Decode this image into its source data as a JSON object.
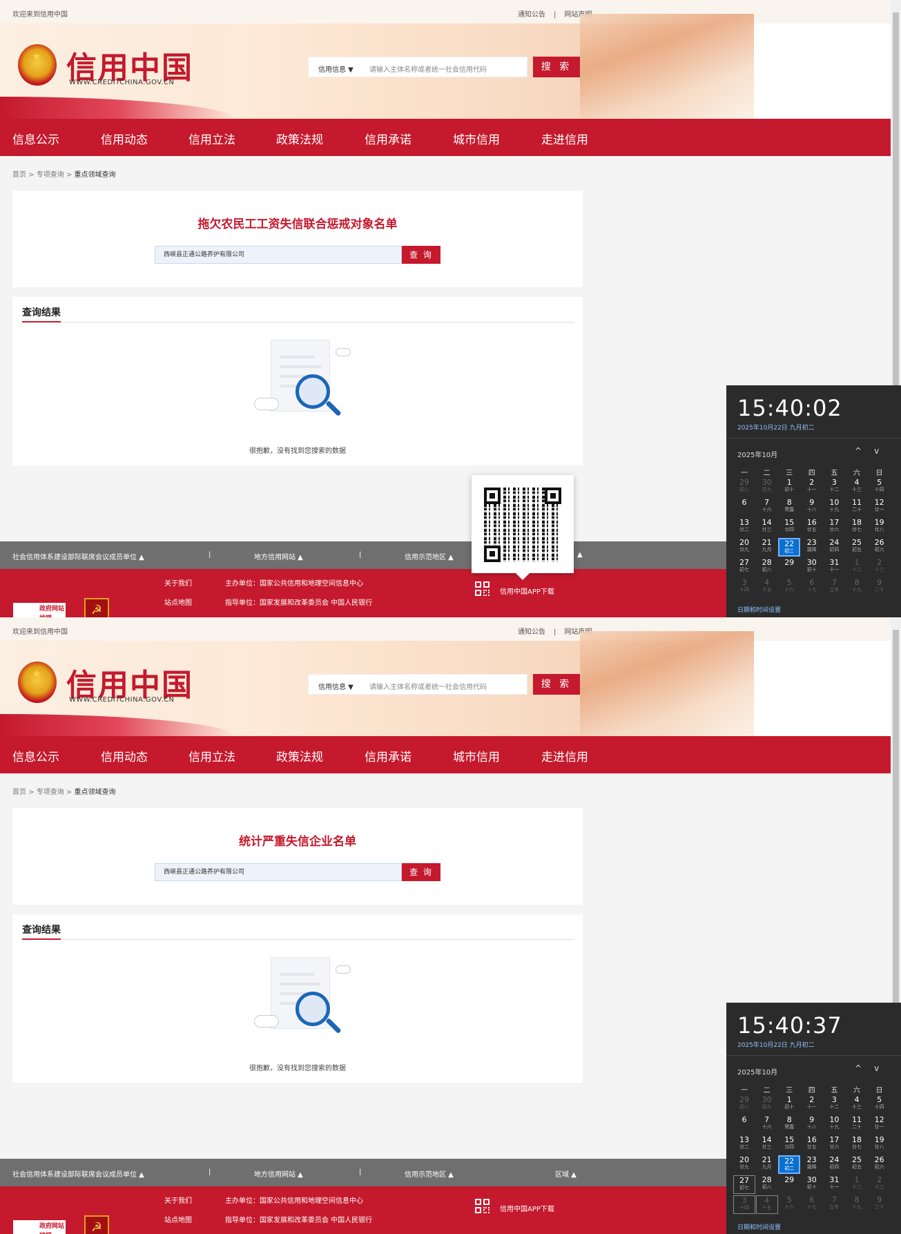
{
  "topbar": {
    "welcome": "欢迎来到信用中国",
    "notice": "通知公告",
    "divider": "|",
    "statement": "网站声明"
  },
  "logo": {
    "title": "信用中国",
    "subtitle": "WWW.CREDITCHINA.GOV.CN"
  },
  "search": {
    "category": "信用信息 ▼",
    "placeholder": "请输入主体名称或者统一社会信用代码",
    "button": "搜 索"
  },
  "nav": [
    "信息公示",
    "信用动态",
    "信用立法",
    "政策法规",
    "信用承诺",
    "城市信用",
    "走进信用"
  ],
  "breadcrumb": {
    "home": "首页",
    "sep1": " > ",
    "section": "专项查询",
    "sep2": " > ",
    "current": "重点领域查询"
  },
  "query": {
    "value": "西峡县正通公路养护有限公司",
    "button": "查 询"
  },
  "results": {
    "title": "查询结果",
    "empty_text": "很抱歉，没有找到您搜索的数据"
  },
  "footer_bar": {
    "item1": "社会信用体系建设部际联席会议成员单位 ▲",
    "pipe": "|",
    "item2": "地方信用网站 ▲",
    "item3": "信用示范地区 ▲",
    "item4": "区域 ▲",
    "item4_partial": "▲"
  },
  "footer": {
    "about": "关于我们",
    "sitemap": "站点地图",
    "host": "主办单位：国家公共信用和地理空间信息中心",
    "guide": "指导单位：国家发展和改革委员会 中国人民银行",
    "app": "信用中国APP下载",
    "gov_badge_top": "政府网站",
    "gov_badge_bottom": "找错"
  },
  "screens": [
    {
      "title": "拖欠农民工工资失信联合惩戒对象名单",
      "clock": "15:40:02"
    },
    {
      "title": "统计严重失信企业名单",
      "clock": "15:40:37"
    }
  ],
  "calendar": {
    "date_line": "2025年10月22日 九月初二",
    "month_label": "2025年10月",
    "up": "^",
    "down": "v",
    "weekdays": [
      "一",
      "二",
      "三",
      "四",
      "五",
      "六",
      "日"
    ],
    "days": [
      {
        "n": "29",
        "l": "初八",
        "dim": true
      },
      {
        "n": "30",
        "l": "初九",
        "dim": true
      },
      {
        "n": "1",
        "l": "初十"
      },
      {
        "n": "2",
        "l": "十一"
      },
      {
        "n": "3",
        "l": "十二"
      },
      {
        "n": "4",
        "l": "十三"
      },
      {
        "n": "5",
        "l": "十四"
      },
      {
        "n": "6",
        "l": ""
      },
      {
        "n": "7",
        "l": "十六"
      },
      {
        "n": "8",
        "l": "寒露"
      },
      {
        "n": "9",
        "l": "十八"
      },
      {
        "n": "10",
        "l": "十九"
      },
      {
        "n": "11",
        "l": "二十"
      },
      {
        "n": "12",
        "l": "廿一"
      },
      {
        "n": "13",
        "l": "廿二"
      },
      {
        "n": "14",
        "l": "廿三"
      },
      {
        "n": "15",
        "l": "廿四"
      },
      {
        "n": "16",
        "l": "廿五"
      },
      {
        "n": "17",
        "l": "廿六"
      },
      {
        "n": "18",
        "l": "廿七"
      },
      {
        "n": "19",
        "l": "廿八"
      },
      {
        "n": "20",
        "l": "廿九"
      },
      {
        "n": "21",
        "l": "九月"
      },
      {
        "n": "22",
        "l": "初二",
        "today": true
      },
      {
        "n": "23",
        "l": "霜降"
      },
      {
        "n": "24",
        "l": "初四"
      },
      {
        "n": "25",
        "l": "初五"
      },
      {
        "n": "26",
        "l": "初六"
      },
      {
        "n": "27",
        "l": "初七"
      },
      {
        "n": "28",
        "l": "初八"
      },
      {
        "n": "29",
        "l": ""
      },
      {
        "n": "30",
        "l": "初十"
      },
      {
        "n": "31",
        "l": "十一"
      },
      {
        "n": "1",
        "l": "十二",
        "dim": true
      },
      {
        "n": "2",
        "l": "十三",
        "dim": true
      },
      {
        "n": "3",
        "l": "十四",
        "dim": true
      },
      {
        "n": "4",
        "l": "十五",
        "dim": true
      },
      {
        "n": "5",
        "l": "十六",
        "dim": true
      },
      {
        "n": "6",
        "l": "十七",
        "dim": true
      },
      {
        "n": "7",
        "l": "立冬",
        "dim": true
      },
      {
        "n": "8",
        "l": "十九",
        "dim": true
      },
      {
        "n": "9",
        "l": "二十",
        "dim": true
      }
    ],
    "settings": "日期和时间设置"
  },
  "colors": {
    "brand_red": "#c5192d",
    "footer_gray": "#6f6f6f",
    "flyout_bg": "#2b2b2b",
    "today_blue": "#0b6fd0"
  }
}
